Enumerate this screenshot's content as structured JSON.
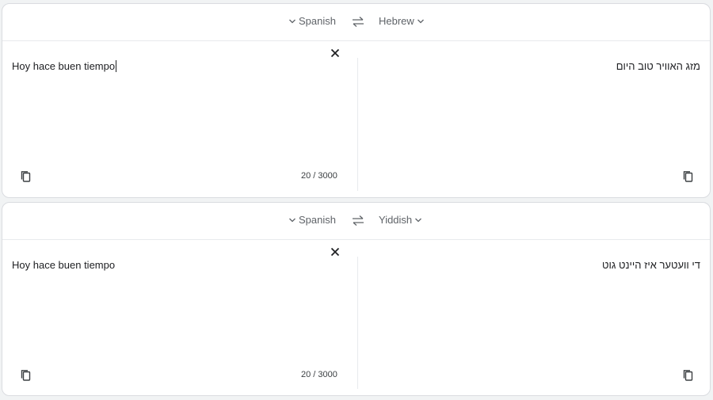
{
  "translations": [
    {
      "source_language": "Spanish",
      "target_language": "Hebrew",
      "source_text": "Hoy hace buen tiempo",
      "translated_text": "מזג האוויר טוב היום",
      "char_count": "20 / 3000"
    },
    {
      "source_language": "Spanish",
      "target_language": "Yiddish",
      "source_text": "Hoy hace buen tiempo",
      "translated_text": "די וועטער איז היינט גוט",
      "char_count": "20 / 3000"
    }
  ],
  "icons": {
    "swap": "swap-arrows-icon",
    "clear": "close-icon",
    "copy": "copy-icon",
    "dropdown": "chevron-down-icon"
  },
  "colors": {
    "background": "#f1f3f4",
    "panel": "#ffffff",
    "border": "#dadce0",
    "muted_text": "#5f6368"
  }
}
